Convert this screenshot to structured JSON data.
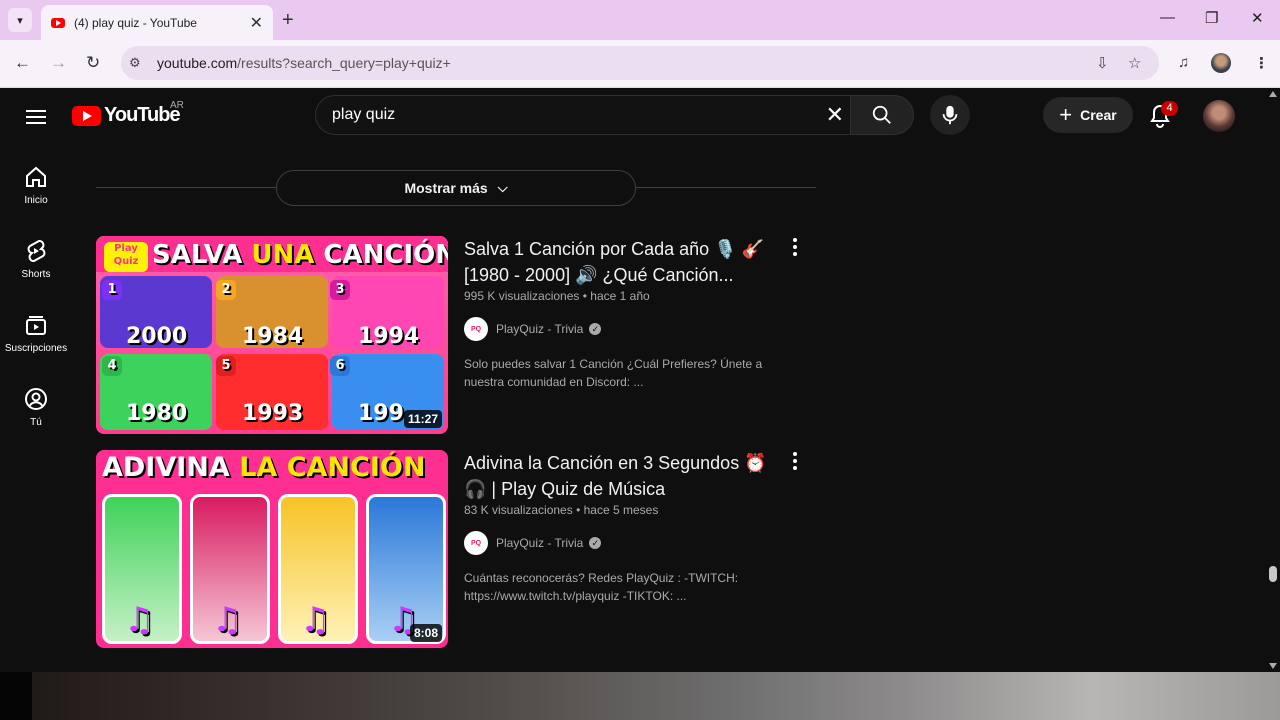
{
  "browser": {
    "tab_title": "(4) play quiz - YouTube",
    "close_glyph": "✕",
    "new_tab_glyph": "+",
    "url_host": "youtube.com",
    "url_path": "/results?search_query=play+quiz+"
  },
  "youtube": {
    "logo_text": "YouTube",
    "country_code": "AR",
    "search_query": "play quiz",
    "clear_glyph": "✕",
    "create_label": "Crear",
    "notification_count": "4",
    "sidebar": [
      {
        "label": "Inicio",
        "icon": "home-icon"
      },
      {
        "label": "Shorts",
        "icon": "shorts-icon"
      },
      {
        "label": "Suscripciones",
        "icon": "subscriptions-icon"
      },
      {
        "label": "Tú",
        "icon": "you-icon"
      }
    ],
    "show_more_label": "Mostrar más",
    "videos": [
      {
        "title": "Salva 1 Canción por Cada año 🎙️ 🎸 [1980 - 2000] 🔊 ¿Qué Canción...",
        "views": "995 K visualizaciones",
        "age": "hace 1 año",
        "channel": "PlayQuiz - Trivia",
        "description": "Solo puedes salvar 1 Canción ¿Cuál Prefieres? Únete a nuestra comunidad en Discord: ...",
        "duration": "11:27",
        "thumb_headline_a": "SALVA ",
        "thumb_headline_b": "UNA",
        "thumb_headline_c": " CANCIÓN",
        "thumb_years": [
          "2000",
          "1984",
          "1994",
          "1980",
          "1993",
          "199"
        ],
        "thumb_nums": [
          "1",
          "2",
          "3",
          "4",
          "5",
          "6"
        ],
        "thumb_badge": "Play Quiz"
      },
      {
        "title": "Adivina la Canción en 3 Segundos ⏰ 🎧 | Play Quiz de Música",
        "views": "83 K visualizaciones",
        "age": "hace 5 meses",
        "channel": "PlayQuiz - Trivia",
        "description": "Cuántas reconocerás? Redes PlayQuiz : -TWITCH: https://www.twitch.tv/playquiz -TIKTOK: ...",
        "duration": "8:08",
        "thumb_headline_a": "ADIVINA ",
        "thumb_headline_b": "LA CANCIÓN"
      }
    ]
  },
  "colors": {
    "brand_red": "#ff0000",
    "background": "#0f0f0f",
    "tab_strip": "#e9c9f0"
  }
}
